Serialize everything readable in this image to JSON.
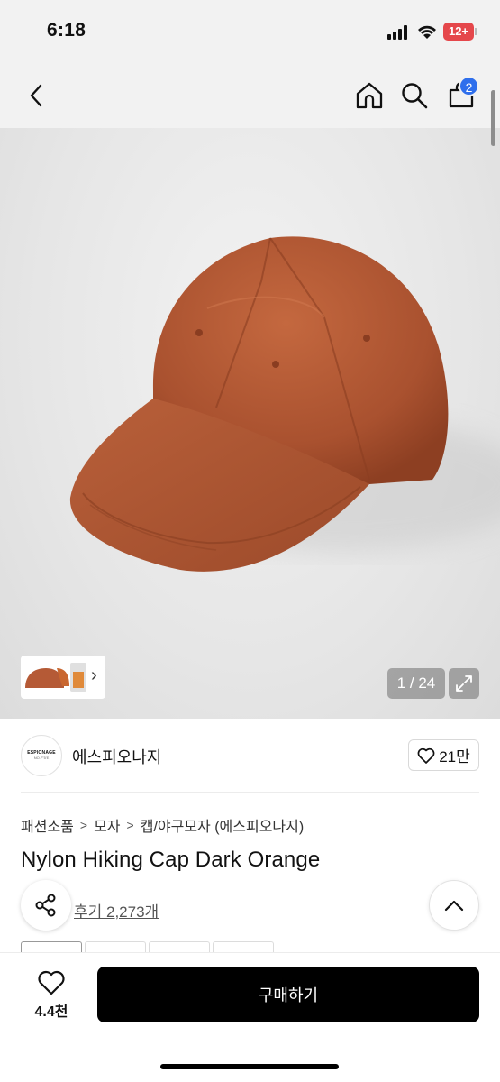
{
  "status": {
    "time": "6:18",
    "battery": "12+"
  },
  "nav": {
    "cart_count": "2",
    "icons": [
      "back-icon",
      "home-icon",
      "search-icon",
      "cart-icon"
    ]
  },
  "gallery": {
    "counter": "1 / 24",
    "thumbnail_arrow": "›"
  },
  "brand": {
    "logo_line1": "ESPIONAGE",
    "logo_line2": "NO.7°5'E",
    "name": "에스피오나지",
    "likes": "21만"
  },
  "breadcrumb": {
    "level1": "패션소품",
    "level2": "모자",
    "level3": "캡/야구모자 (에스피오나지)"
  },
  "product": {
    "title": "Nylon Hiking Cap Dark Orange",
    "reviews": "후기 2,273개",
    "color": "#b35a37"
  },
  "bottom": {
    "wish_count": "4.4천",
    "buy_label": "구매하기"
  }
}
